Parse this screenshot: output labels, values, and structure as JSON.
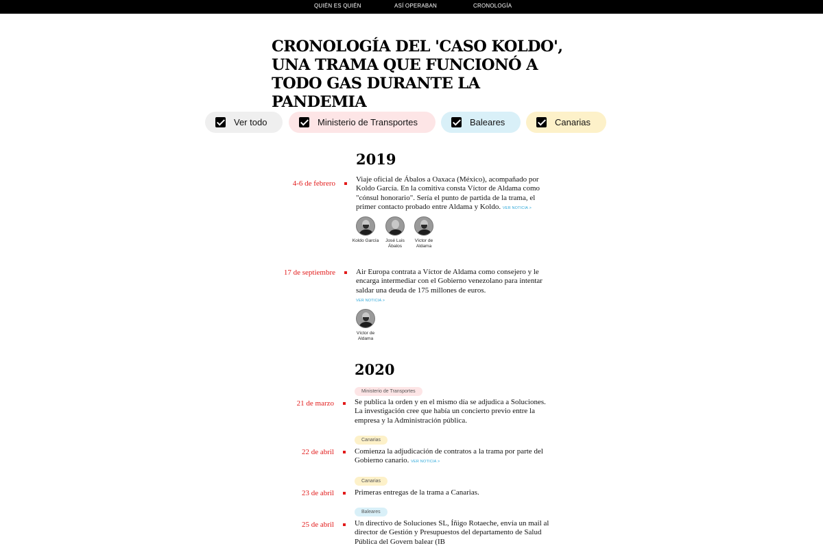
{
  "nav": {
    "items": [
      "QUIÉN ES QUIÉN",
      "ASÍ OPERABAN",
      "CRONOLOGÍA"
    ]
  },
  "title": "CRONOLOGÍA DEL 'CASO KOLDO', UNA TRAMA QUE FUNCIONÓ A TODO GAS DURANTE LA PANDEMIA",
  "filters": [
    {
      "label": "Ver todo",
      "checked": true,
      "color": "#efefef"
    },
    {
      "label": "Ministerio de Transportes",
      "checked": true,
      "color": "#fde5e6"
    },
    {
      "label": "Baleares",
      "checked": true,
      "color": "#d9f0f8"
    },
    {
      "label": "Canarias",
      "checked": true,
      "color": "#fdf1c9"
    }
  ],
  "accent_color": "#e21a1a",
  "link_color": "#2aa6d8",
  "years": [
    {
      "year": "2019",
      "events": [
        {
          "date": "4-6 de febrero",
          "text": "Viaje oficial de Ábalos a Oaxaca (México), acompañado por Koldo García. En la comitiva consta Víctor de Aldama como \"cónsul honorario\". Sería el punto de partida de la trama, el primer contacto probado entre Aldama y Koldo.",
          "link": "VER NOTICIA >",
          "people": [
            {
              "name": "Koldo García"
            },
            {
              "name": "José Luis Ábalos"
            },
            {
              "name": "Víctor de Aldama"
            }
          ]
        },
        {
          "date": "17 de septiembre",
          "text": "Air Europa contrata a Víctor de Aldama como consejero y le encarga intermediar con el Gobierno venezolano para intentar saldar una deuda de 175 millones de euros.",
          "link": "VER NOTICIA >",
          "people": [
            {
              "name": "Víctor de Aldama"
            }
          ]
        }
      ]
    },
    {
      "year": "2020",
      "events": [
        {
          "tag": "Ministerio de Transportes",
          "date": "21 de marzo",
          "text": "Se publica la orden y en el mismo día se adjudica a Soluciones. La investigación cree que había un concierto previo entre la empresa y la Administración pública."
        },
        {
          "tag": "Canarias",
          "date": "22 de abril",
          "text": "Comienza la adjudicación de contratos a la trama por parte del Gobierno canario.",
          "link": "VER NOTICIA >"
        },
        {
          "tag": "Canarias",
          "date": "23 de abril",
          "text": "Primeras entregas de la trama a Canarias."
        },
        {
          "tag": "Baleares",
          "date": "25 de abril",
          "text": "Un directivo de Soluciones SL, Íñigo Rotaeche, envía un mail al director de Gestión y Presupuestos del departamento de Salud Pública del Govern balear (IB"
        }
      ]
    }
  ]
}
